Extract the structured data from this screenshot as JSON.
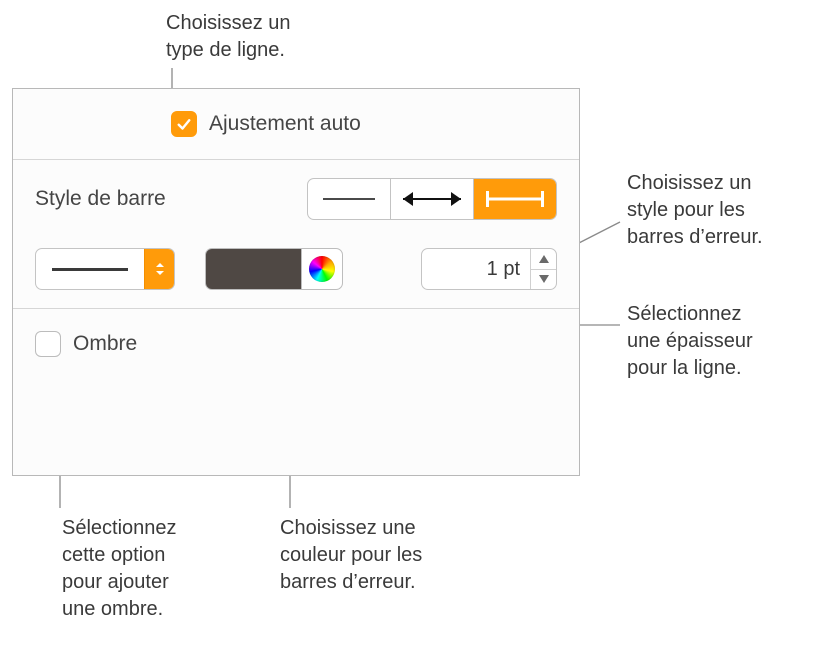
{
  "callouts": {
    "line_type": "Choisissez un\ntype de ligne.",
    "bar_style": "Choisissez un\nstyle pour les\nbarres d’erreur.",
    "thickness": "Sélectionnez\nune épaisseur\npour la ligne.",
    "shadow": "Sélectionnez\ncette option\npour ajouter\nune ombre.",
    "color": "Choisissez une\ncouleur pour les\nbarres d’erreur."
  },
  "panel": {
    "auto_fit": {
      "label": "Ajustement auto",
      "checked": true
    },
    "bar_style_label": "Style de barre",
    "bar_styles": {
      "selected_index": 2
    },
    "line_type": {
      "style": "solid"
    },
    "color": {
      "hex": "#4f4844"
    },
    "thickness": {
      "value": "1 pt"
    },
    "shadow": {
      "label": "Ombre",
      "checked": false
    }
  }
}
